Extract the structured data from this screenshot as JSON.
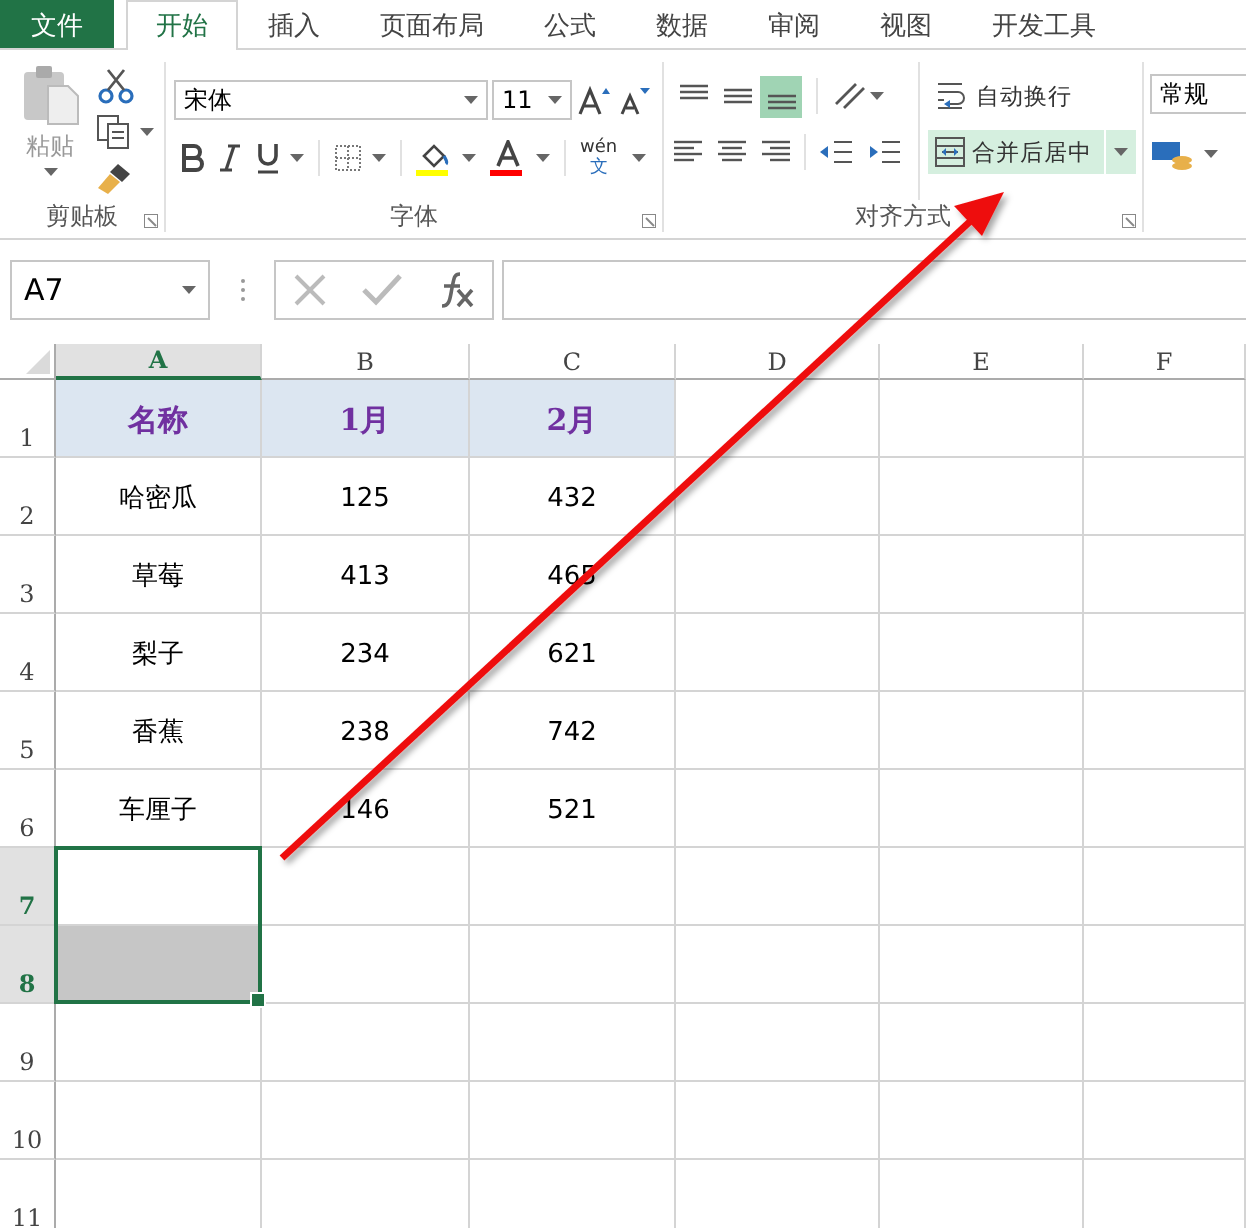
{
  "tabs": [
    {
      "label": "文件",
      "kind": "file",
      "selected": false
    },
    {
      "label": "开始",
      "kind": "tab",
      "selected": true
    },
    {
      "label": "插入",
      "kind": "tab",
      "selected": false
    },
    {
      "label": "页面布局",
      "kind": "tab",
      "selected": false
    },
    {
      "label": "公式",
      "kind": "tab",
      "selected": false
    },
    {
      "label": "数据",
      "kind": "tab",
      "selected": false
    },
    {
      "label": "审阅",
      "kind": "tab",
      "selected": false
    },
    {
      "label": "视图",
      "kind": "tab",
      "selected": false
    },
    {
      "label": "开发工具",
      "kind": "tab",
      "selected": false
    }
  ],
  "ribbon": {
    "clipboard": {
      "paste_label": "粘贴",
      "group_label": "剪贴板"
    },
    "font": {
      "font_name": "宋体",
      "font_size": "11",
      "phonetic_top": "wén",
      "phonetic_bottom": "文",
      "group_label": "字体"
    },
    "alignment": {
      "vertical_align": [
        {
          "selected": false
        },
        {
          "selected": false
        },
        {
          "selected": true
        }
      ],
      "wrap_text": "自动换行",
      "merge_center": {
        "label": "合并后居中",
        "highlighted": true
      },
      "group_label": "对齐方式"
    },
    "number": {
      "format": "常规"
    }
  },
  "formula_bar": {
    "name_box": "A7"
  },
  "sheet": {
    "columns": [
      {
        "label": "A",
        "selected": true
      },
      {
        "label": "B",
        "selected": false
      },
      {
        "label": "C",
        "selected": false
      },
      {
        "label": "D",
        "selected": false
      },
      {
        "label": "E",
        "selected": false
      },
      {
        "label": "F",
        "selected": false
      }
    ],
    "rows": [
      {
        "label": "1",
        "kind": "header",
        "selected": false,
        "cells": [
          "名称",
          "1月",
          "2月"
        ]
      },
      {
        "label": "2",
        "kind": "data",
        "selected": false,
        "cells": [
          "哈密瓜",
          "125",
          "432"
        ]
      },
      {
        "label": "3",
        "kind": "data",
        "selected": false,
        "cells": [
          "草莓",
          "413",
          "465"
        ]
      },
      {
        "label": "4",
        "kind": "data",
        "selected": false,
        "cells": [
          "梨子",
          "234",
          "621"
        ]
      },
      {
        "label": "5",
        "kind": "data",
        "selected": false,
        "cells": [
          "香蕉",
          "238",
          "742"
        ]
      },
      {
        "label": "6",
        "kind": "data",
        "selected": false,
        "cells": [
          "车厘子",
          "146",
          "521"
        ]
      },
      {
        "label": "7",
        "kind": "data",
        "selected": true
      },
      {
        "label": "8",
        "kind": "data",
        "selected": true
      },
      {
        "label": "9",
        "kind": "data",
        "selected": false
      },
      {
        "label": "10",
        "kind": "data",
        "selected": false
      },
      {
        "label": "11",
        "kind": "data",
        "selected": false
      }
    ]
  }
}
